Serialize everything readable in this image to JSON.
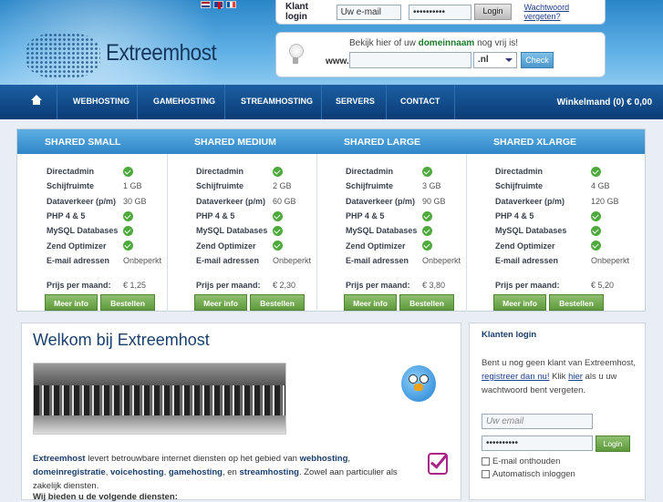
{
  "header": {
    "brand": "Extreemhost",
    "languages": [
      "nl",
      "en",
      "fr"
    ],
    "login": {
      "label": "Klant login",
      "email_value": "Uw e-mail",
      "password_value": "••••••••••",
      "button": "Login",
      "forgot_link": "Wachtwoord vergeten?"
    },
    "domain": {
      "question_pre": "Bekijk hier of uw",
      "question_bold": "domeinnaam",
      "question_post": "nog vrij is!",
      "prefix": "www.",
      "input_value": "",
      "tld": ".nl",
      "button": "Check"
    }
  },
  "nav": {
    "items": [
      "WEBHOSTING",
      "GAMEHOSTING",
      "STREAMHOSTING",
      "SERVERS",
      "CONTACT"
    ],
    "cart": "Winkelmand (0) € 0,00"
  },
  "plans": [
    {
      "name": "SHARED SMALL",
      "directadmin": "check",
      "schijfruimte": "1 GB",
      "dataverkeer": "30 GB",
      "php": "check",
      "mysql": "check",
      "zend": "check",
      "email": "Onbeperkt",
      "prijs": "€ 1,25"
    },
    {
      "name": "SHARED MEDIUM",
      "directadmin": "check",
      "schijfruimte": "2 GB",
      "dataverkeer": "60 GB",
      "php": "check",
      "mysql": "check",
      "zend": "check",
      "email": "Onbeperkt",
      "prijs": "€ 2,30"
    },
    {
      "name": "SHARED LARGE",
      "directadmin": "check",
      "schijfruimte": "3 GB",
      "dataverkeer": "90 GB",
      "php": "check",
      "mysql": "check",
      "zend": "check",
      "email": "Onbeperkt",
      "prijs": "€ 3,80"
    },
    {
      "name": "SHARED XLARGE",
      "directadmin": "check",
      "schijfruimte": "4 GB",
      "dataverkeer": "120 GB",
      "php": "check",
      "mysql": "check",
      "zend": "check",
      "email": "Onbeperkt",
      "prijs": "€ 5,20"
    }
  ],
  "plan_labels": {
    "directadmin": "Directadmin",
    "schijfruimte": "Schijfruimte",
    "dataverkeer": "Dataverkeer (p/m)",
    "php": "PHP 4 & 5",
    "mysql": "MySQL Databases",
    "zend": "Zend Optimizer",
    "email": "E-mail adressen",
    "prijs": "Prijs per maand:",
    "meer_info": "Meer info",
    "bestellen": "Bestellen"
  },
  "welcome": {
    "title": "Welkom bij Extreemhost",
    "text_parts": [
      {
        "t": "Extreemhost",
        "b": true
      },
      {
        "t": " levert betrouwbare internet diensten op het gebied van ",
        "b": false
      },
      {
        "t": "webhosting",
        "b": true
      },
      {
        "t": ", ",
        "b": false
      },
      {
        "t": "domeinregistratie",
        "b": true
      },
      {
        "t": ", ",
        "b": false
      },
      {
        "t": "voicehosting",
        "b": true
      },
      {
        "t": ", ",
        "b": false
      },
      {
        "t": "gamehosting",
        "b": true
      },
      {
        "t": ", en ",
        "b": false
      },
      {
        "t": "streamhosting",
        "b": true
      },
      {
        "t": ". Zowel aan particulier als zakelijk diensten.",
        "b": false
      }
    ],
    "cut_heading": "Wij bieden u de volgende diensten:"
  },
  "klant": {
    "title": "Klanten login",
    "text_a": "Bent u nog geen klant van Extreemhost, ",
    "link_register": "registreer dan nu!",
    "text_b": " Klik ",
    "link_here": "hier",
    "text_c": " als u uw wachtwoord bent vergeten.",
    "email_placeholder": "Uw email",
    "password_value": "••••••••••",
    "button": "Login",
    "remember": "E-mail onthouden",
    "auto": "Automatisch inloggen"
  },
  "colors": {
    "accent": "#2f86c7",
    "green": "#5d9a3c",
    "nav": "#0b3c75"
  }
}
